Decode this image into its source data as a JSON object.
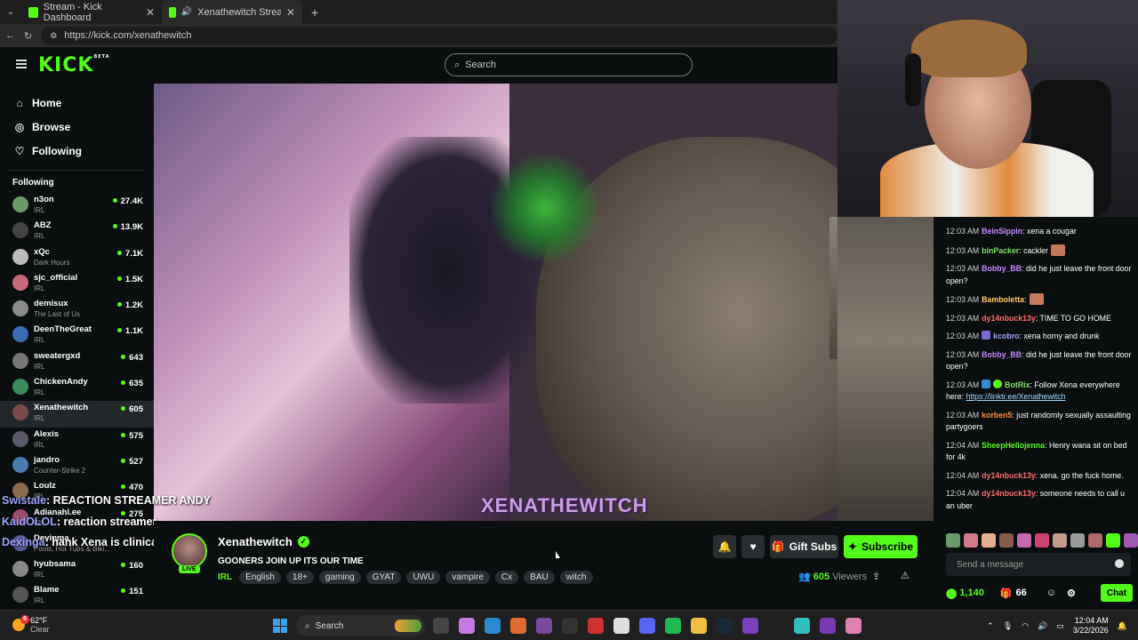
{
  "browser": {
    "tabs": [
      {
        "label": "Stream - Kick Dashboard",
        "active": false
      },
      {
        "label": "Xenathewitch Stream - Watch",
        "active": true
      }
    ],
    "url": "https://kick.com/xenathewitch",
    "new_tab": "+"
  },
  "kick": {
    "logo": "KICK",
    "logo_badge": "BETA",
    "search_placeholder": "Search"
  },
  "sidebar": {
    "nav": [
      {
        "label": "Home",
        "icon": "home-icon"
      },
      {
        "label": "Browse",
        "icon": "compass-icon"
      },
      {
        "label": "Following",
        "icon": "heart-icon"
      }
    ],
    "following_title": "Following",
    "channels": [
      {
        "name": "n3on",
        "category": "IRL",
        "viewers": "27.4K",
        "color": "#6a9a6a"
      },
      {
        "name": "ABZ",
        "category": "IRL",
        "viewers": "13.9K",
        "color": "#444444"
      },
      {
        "name": "xQc",
        "category": "Dark Hours",
        "viewers": "7.1K",
        "color": "#bbbbbb"
      },
      {
        "name": "sjc_official",
        "category": "IRL",
        "viewers": "1.5K",
        "color": "#c46a7a"
      },
      {
        "name": "demisux",
        "category": "The Last of Us",
        "viewers": "1.2K",
        "color": "#8a8a8a"
      },
      {
        "name": "DeenTheGreat",
        "category": "IRL",
        "viewers": "1.1K",
        "color": "#3a6ab0"
      },
      {
        "name": "sweatergxd",
        "category": "IRL",
        "viewers": "643",
        "color": "#777777"
      },
      {
        "name": "ChickenAndy",
        "category": "IRL",
        "viewers": "635",
        "color": "#3a8a5a"
      },
      {
        "name": "Xenathewitch",
        "category": "IRL",
        "viewers": "605",
        "color": "#7a4a4a",
        "selected": true
      },
      {
        "name": "Alexis",
        "category": "IRL",
        "viewers": "575",
        "color": "#5a5a6a"
      },
      {
        "name": "jandro",
        "category": "Counter-Strike 2",
        "viewers": "527",
        "color": "#4a7ab0"
      },
      {
        "name": "Loulz",
        "category": "IRL",
        "viewers": "470",
        "color": "#8a6a4a"
      },
      {
        "name": "Adianahl.ee",
        "category": "IRL",
        "viewers": "275",
        "color": "#9a4a6a"
      },
      {
        "name": "Devinma",
        "category": "Pools, Hot Tubs & Biki...",
        "viewers": "",
        "color": "#5a5a9a"
      },
      {
        "name": "hyubsama",
        "category": "IRL",
        "viewers": "160",
        "color": "#888888"
      },
      {
        "name": "Blame",
        "category": "IRL",
        "viewers": "151",
        "color": "#555555"
      }
    ]
  },
  "overlay_chat": [
    {
      "user": "Swistale",
      "text": ": REACTION STREAMER ANDY"
    },
    {
      "user": "KaidOLOL",
      "text": ": reaction streamer"
    },
    {
      "user": "Dexinga",
      "text": ": hank Xena is clinically psychotic"
    }
  ],
  "video": {
    "watermark": "XENATHEWITCH"
  },
  "stream": {
    "streamer": "Xenathewitch",
    "live_badge": "LIVE",
    "title": "GOONERS JOIN UP ITS OUR TIME",
    "category": "IRL",
    "tags": [
      "English",
      "18+",
      "gaming",
      "GYAT",
      "UWU",
      "vampire",
      "Cx",
      "BAU",
      "witch"
    ],
    "gift_label": "Gift Subs",
    "subscribe_label": "Subscribe",
    "viewers": "605",
    "viewers_label": "Viewers"
  },
  "chat": {
    "messages": [
      {
        "time": "12:03 AM",
        "user": "BeinSippin",
        "color": "#c38bff",
        "text": ": xena a cougar"
      },
      {
        "time": "12:03 AM",
        "user": "binPacker",
        "color": "#7fe06a",
        "text": ": cackler",
        "emote": true
      },
      {
        "time": "12:03 AM",
        "user": "Bobby_BB",
        "color": "#c38bff",
        "text": ": did he just leave the front door open?"
      },
      {
        "time": "12:03 AM",
        "user": "Bamboletta",
        "color": "#ffcc66",
        "text": ":",
        "emote": true
      },
      {
        "time": "12:03 AM",
        "user": "dy14nbuck13y",
        "color": "#ff6b6b",
        "text": ": TIME TO GO HOME"
      },
      {
        "time": "12:03 AM",
        "user": "kcobro",
        "color": "#9aa3ff",
        "text": ": xena horny and drunk"
      },
      {
        "time": "12:03 AM",
        "user": "Bobby_BB",
        "color": "#c38bff",
        "text": ": did he just leave the front door open?"
      },
      {
        "time": "12:03 AM",
        "user": "BotRix",
        "color": "#7fe06a",
        "text": ": Follow Xena everywhere here: ",
        "link": "https://linktr.ee/Xenathewitch"
      },
      {
        "time": "12:03 AM",
        "user": "korben5",
        "color": "#ff8c42",
        "text": ": just randomly sexually assaulting partygoers"
      },
      {
        "time": "12:04 AM",
        "user": "SheepHellojenna",
        "color": "#53fc18",
        "text": ": Henry wana sit on bed for 4k"
      },
      {
        "time": "12:04 AM",
        "user": "dy14nbuck13y",
        "color": "#ff6b6b",
        "text": ": xena. go the fuck home."
      },
      {
        "time": "12:04 AM",
        "user": "dy14nbuck13y",
        "color": "#ff6b6b",
        "text": ": someone needs to call u an uber"
      }
    ],
    "input_placeholder": "Send a message",
    "points": "1,140",
    "gifts": "66",
    "chat_button": "Chat"
  },
  "taskbar": {
    "temp": "62°F",
    "weather": "Clear",
    "weather_badge": "6",
    "search_label": "Search",
    "time": "12:04 AM",
    "date": "3/22/2026"
  }
}
